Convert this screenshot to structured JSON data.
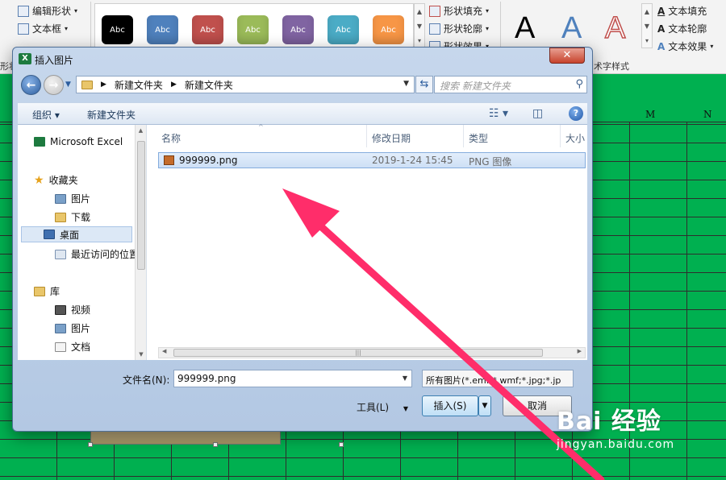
{
  "ribbon": {
    "left_items": [
      "编辑形状",
      "文本框"
    ],
    "style_swatches": [
      {
        "label": "Abc",
        "color": "#000000"
      },
      {
        "label": "Abc",
        "color": "#4f81bd"
      },
      {
        "label": "Abc",
        "color": "#c0504d"
      },
      {
        "label": "Abc",
        "color": "#9bbb59"
      },
      {
        "label": "Abc",
        "color": "#8064a2"
      },
      {
        "label": "Abc",
        "color": "#4bacc6"
      },
      {
        "label": "Abc",
        "color": "#f79646"
      }
    ],
    "shape_fill": "形状填充",
    "shape_outline": "形状轮廓",
    "shape_effects": "形状效果",
    "text_fill": "文本填充",
    "text_outline": "文本轮廓",
    "text_effects": "文本效果",
    "art_letter": "A",
    "wordart_group": "术字样式",
    "left_group": "形状"
  },
  "sheet": {
    "columns": [
      "M",
      "N"
    ]
  },
  "dialog": {
    "title": "插入图片",
    "close_label": "✕",
    "address_path": [
      "新建文件夹",
      "新建文件夹"
    ],
    "search_placeholder": "搜索 新建文件夹",
    "toolbar": {
      "organize": "组织 ▾",
      "new_folder": "新建文件夹"
    },
    "nav": {
      "app_item": "Microsoft Excel",
      "favorites": "收藏夹",
      "favorites_items": [
        "图片",
        "下载",
        "桌面",
        "最近访问的位置"
      ],
      "libraries": "库",
      "library_items": [
        "视频",
        "图片",
        "文档"
      ]
    },
    "columns": {
      "name": "名称",
      "modified": "修改日期",
      "type": "类型",
      "size": "大小"
    },
    "files": [
      {
        "name": "999999.png",
        "modified": "2019-1-24 15:45",
        "type": "PNG 图像"
      }
    ],
    "filename_label": "文件名(N):",
    "filename_value": "999999.png",
    "filetype_value": "所有图片(*.emf;*.wmf;*.jpg;*.jp",
    "tools_label": "工具(L)",
    "insert_label": "插入(S)",
    "cancel_label": "取消"
  },
  "watermark": {
    "main": "Bai 经验",
    "sub": "jingyan.baidu.com"
  }
}
